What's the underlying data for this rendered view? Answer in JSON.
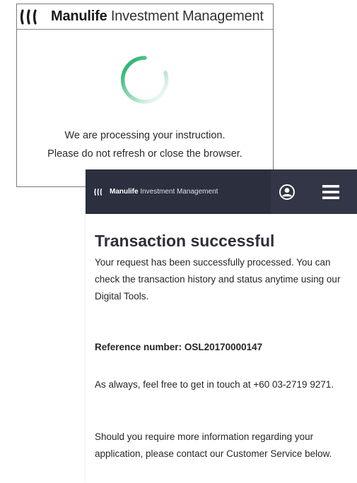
{
  "processing": {
    "brand_bold": "Manulife",
    "brand_light": "Investment Management",
    "line_1": "We are processing your instruction.",
    "line_2": "Please do not refresh or close the browser."
  },
  "result": {
    "brand_bold": "Manulife",
    "brand_light": "Investment Management",
    "title": "Transaction successful",
    "success_text": "Your request has been successfully processed. You can check the transaction history and status anytime using our Digital Tools.",
    "reference_label": "Reference number:",
    "reference_value": "OSL20170000147",
    "contact_text": "As always, feel free to get in touch at +60 03-2719 9271.",
    "more_info_text": "Should you require more information regarding your application, please contact our Customer Service below."
  },
  "icons": {
    "logo": "manulife-logo-icon",
    "spinner": "loading-spinner-icon",
    "account": "account-icon",
    "menu": "hamburger-menu-icon"
  },
  "colors": {
    "brand_green": "#00a758",
    "header_dark": "#323646",
    "header_brand_area": "#2b2f3e",
    "title_text": "#2f2f3a"
  }
}
